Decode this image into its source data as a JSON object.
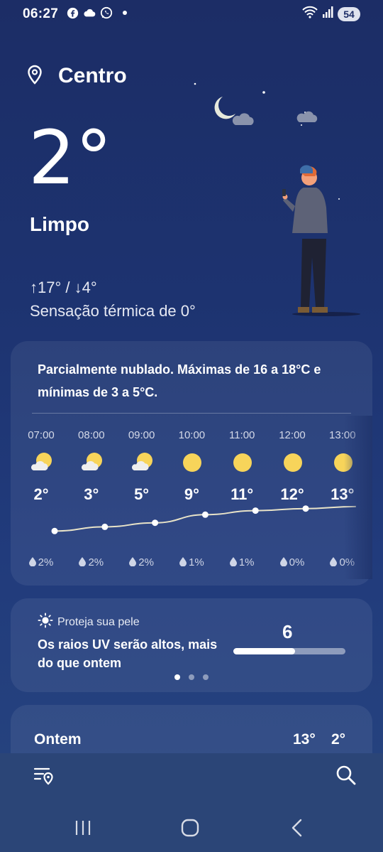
{
  "status_bar": {
    "time": "06:27",
    "battery": "54",
    "icons": [
      "facebook-icon",
      "cloud-icon",
      "whatsapp-icon",
      "dot-icon",
      "wifi-icon",
      "signal-icon"
    ]
  },
  "location": {
    "name": "Centro",
    "icon": "location-pin-icon"
  },
  "current": {
    "temperature": "2°",
    "condition": "Limpo",
    "high_low": "↑17° / ↓4°",
    "feels_like": "Sensação térmica de 0°"
  },
  "forecast": {
    "summary": "Parcialmente nublado. Máximas de 16 a 18°C e mínimas de 3 a 5°C.",
    "hours": [
      {
        "time": "07:00",
        "icon": "partly-cloudy-sun-icon",
        "temp": "2°",
        "temp_value": 2,
        "precip": "2%"
      },
      {
        "time": "08:00",
        "icon": "partly-cloudy-sun-icon",
        "temp": "3°",
        "temp_value": 3,
        "precip": "2%"
      },
      {
        "time": "09:00",
        "icon": "partly-cloudy-sun-icon",
        "temp": "5°",
        "temp_value": 5,
        "precip": "2%"
      },
      {
        "time": "10:00",
        "icon": "sun-icon",
        "temp": "9°",
        "temp_value": 9,
        "precip": "1%"
      },
      {
        "time": "11:00",
        "icon": "sun-icon",
        "temp": "11°",
        "temp_value": 11,
        "precip": "1%"
      },
      {
        "time": "12:00",
        "icon": "sun-icon",
        "temp": "12°",
        "temp_value": 12,
        "precip": "0%"
      },
      {
        "time": "13:00",
        "icon": "sun-icon",
        "temp": "13°",
        "temp_value": 13,
        "precip": "0%"
      }
    ]
  },
  "uv": {
    "label": "Proteja sua pele",
    "text": "Os raios UV serão altos, mais do que ontem",
    "value": "6",
    "level_fraction": 0.55,
    "page_count": 3,
    "active_page": 0
  },
  "yesterday": {
    "label": "Ontem",
    "max": "13°",
    "min": "2°"
  },
  "bottom_bar": {
    "left_icon": "locations-list-icon",
    "right_icon": "search-icon"
  },
  "nav": {
    "icons": [
      "recent-apps-icon",
      "home-icon",
      "back-icon"
    ]
  },
  "colors": {
    "background": "#1c2d66",
    "sun": "#f7d45a",
    "line": "#e8e3c8"
  }
}
